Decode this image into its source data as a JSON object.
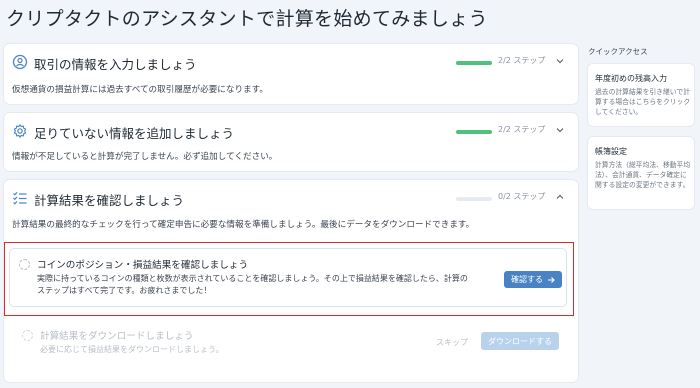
{
  "page": {
    "title": "クリプタクトのアシスタントで計算を始めてみましょう"
  },
  "cards": [
    {
      "title": "取引の情報を入力しましょう",
      "steps": "2/2 ステップ",
      "progress": 1.0,
      "description": "仮想通貨の損益計算には過去すべての取引履歴が必要になります。",
      "icon": "user-settings-icon",
      "expanded": false
    },
    {
      "title": "足りていない情報を追加しましょう",
      "steps": "2/2 ステップ",
      "progress": 1.0,
      "description": "情報が不足していると計算が完了しません。必ず追加してください。",
      "icon": "gear-icon",
      "expanded": false
    },
    {
      "title": "計算結果を確認しましょう",
      "steps": "0/2 ステップ",
      "progress": 0.0,
      "description": "計算結果の最終的なチェックを行って確定申告に必要な情報を準備しましょう。最後にデータをダウンロードできます。",
      "icon": "checklist-icon",
      "expanded": true
    }
  ],
  "tasks": [
    {
      "title": "コインのポジション・損益結果を確認しましょう",
      "description_line1": "実際に持っているコインの種類と枚数が表示されていることを確認しましょう。その上で損益結果を確認したら、計算の",
      "description_line2": "ステップはすべて完了です。お疲れさまでした！",
      "button_label": "確認する",
      "highlighted": true
    },
    {
      "title": "計算結果をダウンロードしましょう",
      "description_line1": "必要に応じて損益結果をダウンロードしましょう。",
      "skip_label": "スキップ",
      "button_label": "ダウンロードする",
      "disabled": true
    }
  ],
  "sidebar": {
    "title": "クイックアクセス",
    "items": [
      {
        "title": "年度初めの残高入力",
        "description": "過去の計算結果を引き継いで計算する場合はこちらをクリックしてください。"
      },
      {
        "title": "帳簿設定",
        "description": "計算方法（総平均法、移動平均法）、会計通貨、データ確定に関する設定の変更ができます。"
      }
    ]
  },
  "colors": {
    "progress_done": "#4cc27c",
    "accent": "#4a83c4",
    "highlight_border": "#e02a2a"
  }
}
